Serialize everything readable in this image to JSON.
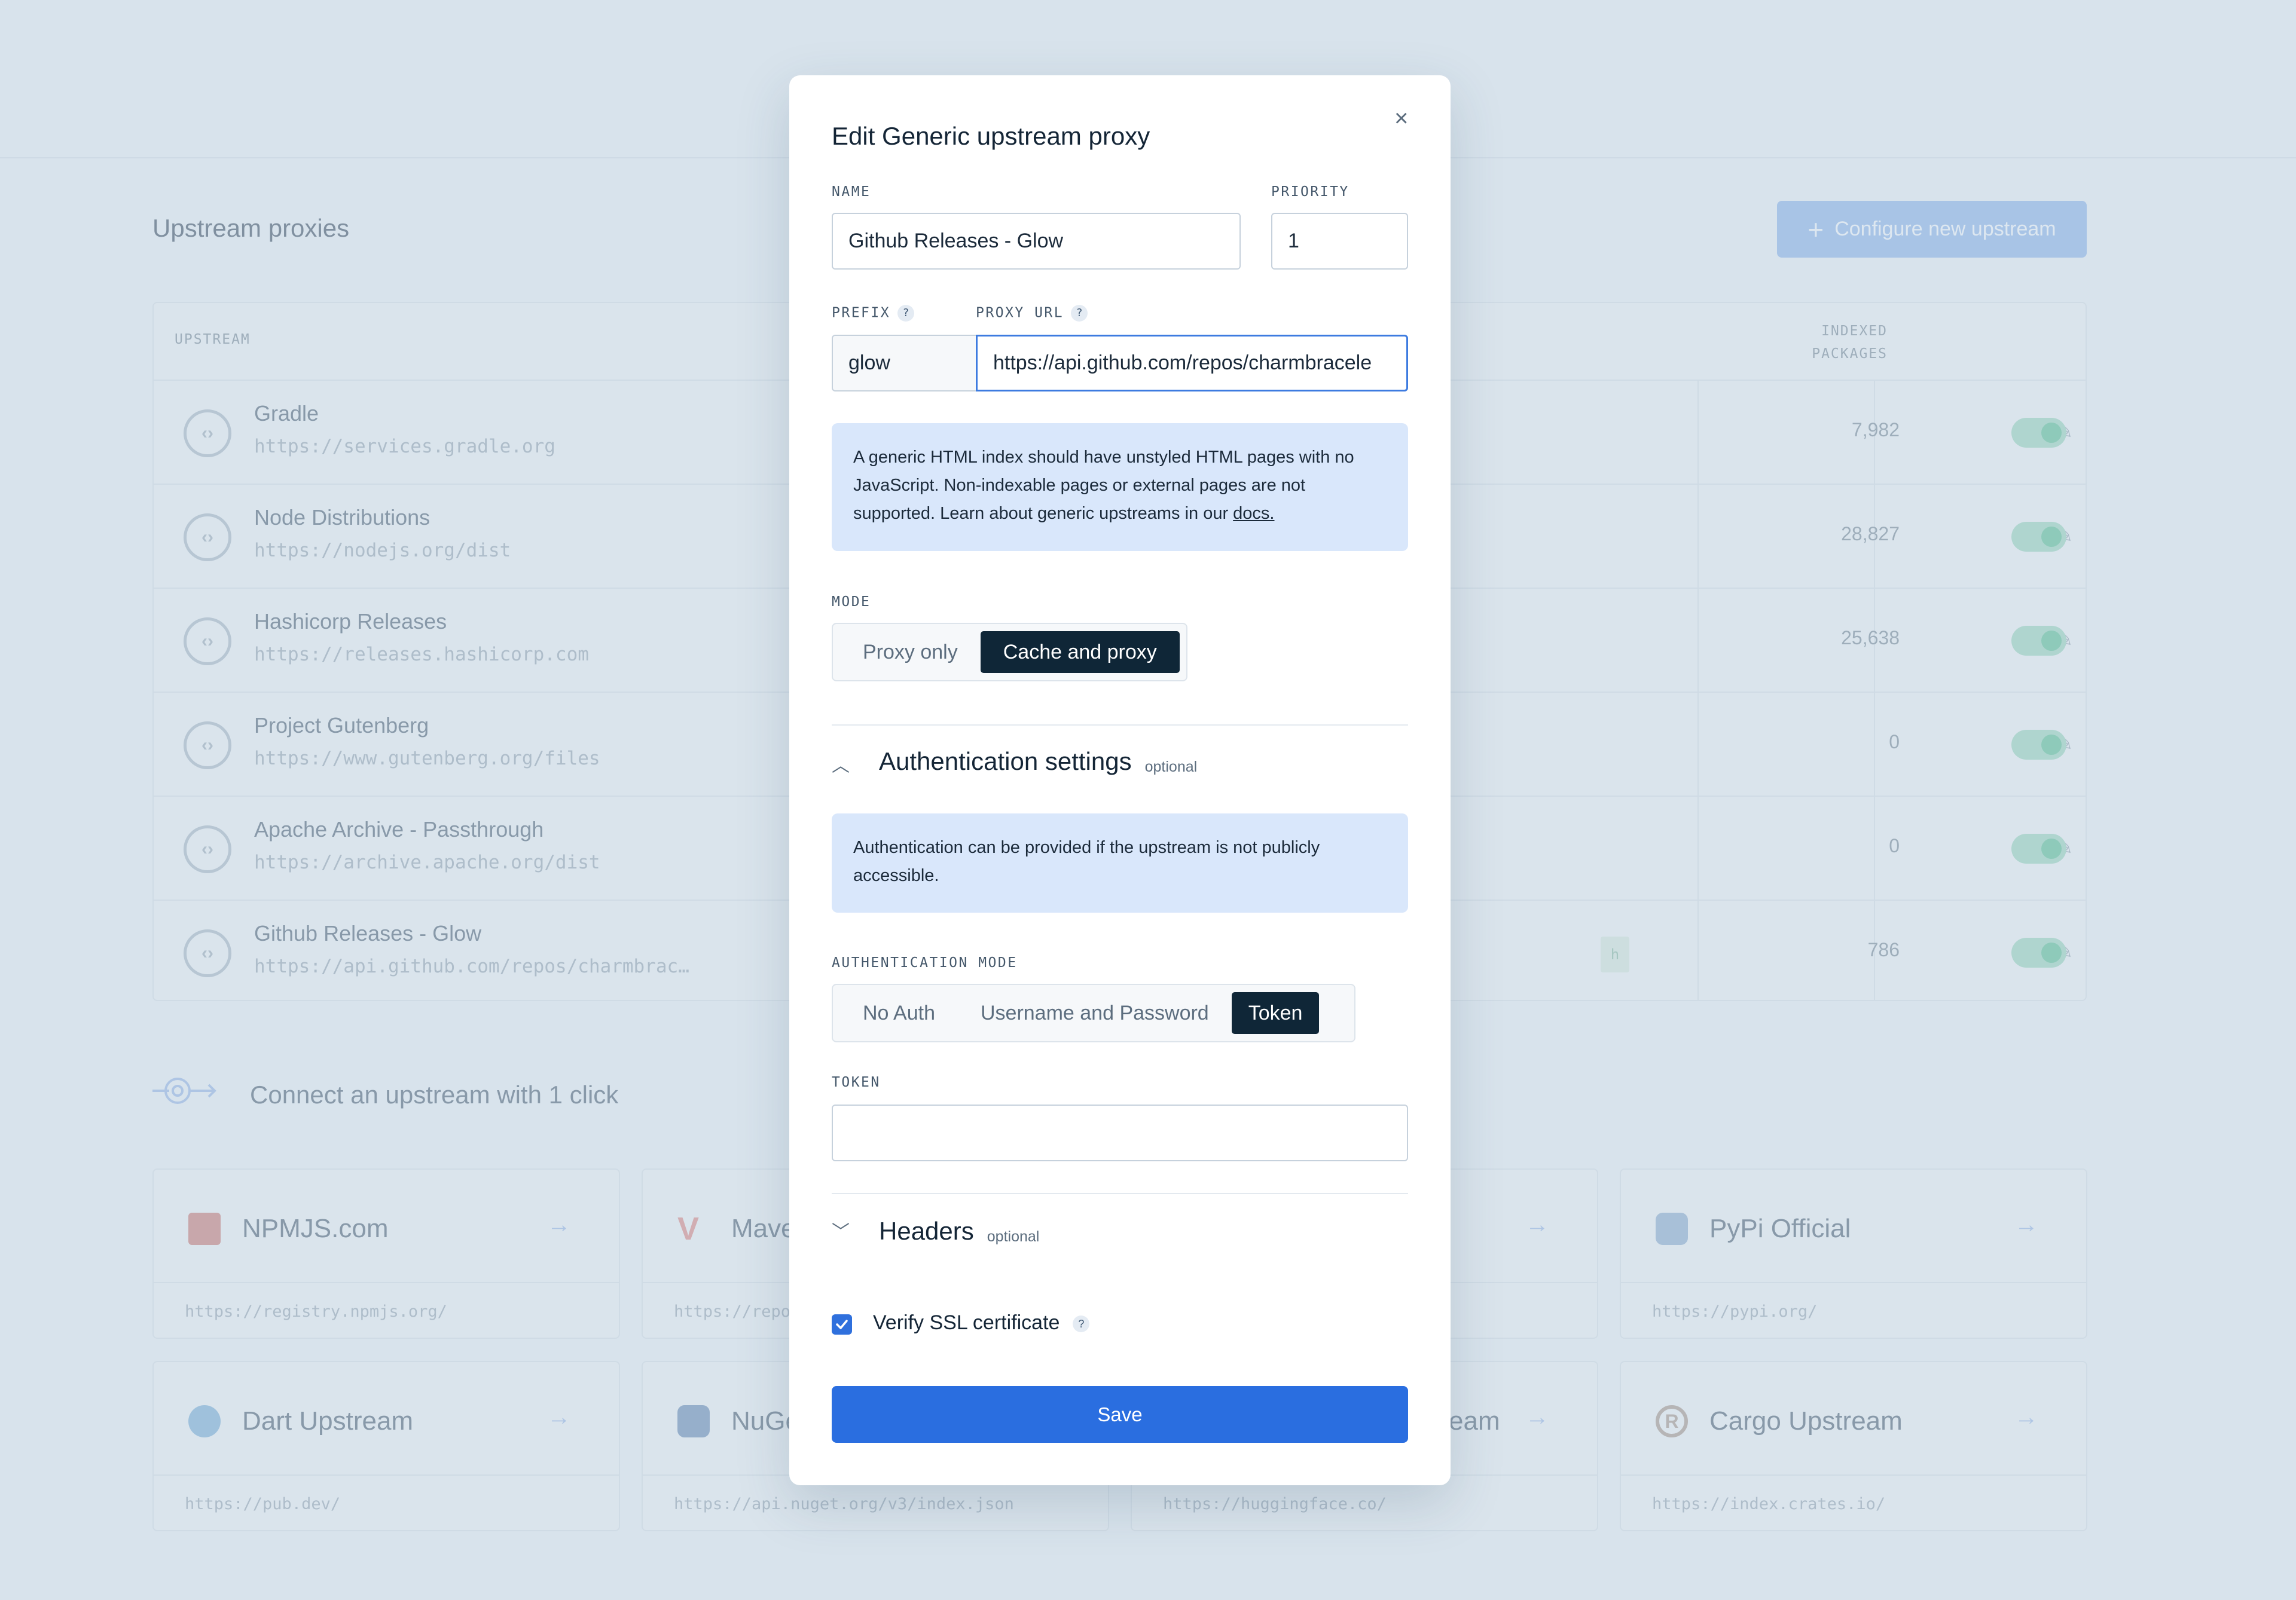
{
  "background": {
    "page_title": "Upstream proxies",
    "configure_button": "Configure new upstream",
    "table": {
      "col_upstream": "UPSTREAM",
      "col_indexed_line1": "INDEXED",
      "col_indexed_line2": "PACKAGES",
      "rows": [
        {
          "name": "Gradle",
          "url": "https://services.gradle.org",
          "count": "7,982"
        },
        {
          "name": "Node Distributions",
          "url": "https://nodejs.org/dist",
          "count": "28,827"
        },
        {
          "name": "Hashicorp Releases",
          "url": "https://releases.hashicorp.com",
          "count": "25,638"
        },
        {
          "name": "Project Gutenberg",
          "url": "https://www.gutenberg.org/files",
          "count": "0"
        },
        {
          "name": "Apache Archive - Passthrough",
          "url": "https://archive.apache.org/dist",
          "count": "0"
        },
        {
          "name": "Github Releases - Glow",
          "url": "https://api.github.com/repos/charmbrac…",
          "count": "786"
        }
      ],
      "row6_tag": "h"
    },
    "connect_title": "Connect an upstream with 1 click",
    "cards": [
      {
        "name": "NPMJS.com",
        "url": "https://registry.npmjs.org/",
        "color": "#c9807f"
      },
      {
        "name": "Mave",
        "url": "https://repo",
        "color": "#d98a8a"
      },
      {
        "name": "",
        "url": "",
        "color": "#c7d2dc"
      },
      {
        "name": "PyPi Official",
        "url": "https://pypi.org/",
        "color": "#8faed0"
      },
      {
        "name": "Dart Upstream",
        "url": "https://pub.dev/",
        "color": "#7fb0d8"
      },
      {
        "name": "NuGe",
        "url": "https://api.nuget.org/v3/index.json",
        "color": "#6e8fb8"
      },
      {
        "name": "eam",
        "url": "https://huggingface.co/",
        "color": "#c7d2dc"
      },
      {
        "name": "Cargo Upstream",
        "url": "https://index.crates.io/",
        "color": "#a89a92"
      }
    ]
  },
  "modal": {
    "title": "Edit Generic upstream proxy",
    "close_glyph": "×",
    "name_label": "NAME",
    "name_value": "Github Releases - Glow",
    "priority_label": "PRIORITY",
    "priority_value": "1",
    "prefix_label": "PREFIX",
    "prefix_value": "glow",
    "proxy_url_label": "PROXY URL",
    "proxy_url_value": "https://api.github.com/repos/charmbracele",
    "help_glyph": "?",
    "info_text": "A generic HTML index should have unstyled HTML pages with no JavaScript. Non-indexable pages or external pages are not supported. Learn about generic upstreams in our ",
    "info_link": "docs.",
    "mode_label": "MODE",
    "mode_options": [
      "Proxy only",
      "Cache and proxy"
    ],
    "mode_selected": "Cache and proxy",
    "auth_section_title": "Authentication settings",
    "optional_label": "optional",
    "auth_info": "Authentication can be provided if the upstream is not publicly accessible.",
    "auth_mode_label": "AUTHENTICATION MODE",
    "auth_mode_options": [
      "No Auth",
      "Username and Password",
      "Token"
    ],
    "auth_mode_selected": "Token",
    "token_label": "TOKEN",
    "token_value": "",
    "headers_title": "Headers",
    "verify_ssl_label": "Verify SSL certificate",
    "verify_ssl_checked": true,
    "save_label": "Save"
  },
  "colors": {
    "primary": "#2a6ee0",
    "dark_active": "#0f2637",
    "info_bg": "#d9e7fb",
    "toggle_on": "#5fbf9a"
  }
}
